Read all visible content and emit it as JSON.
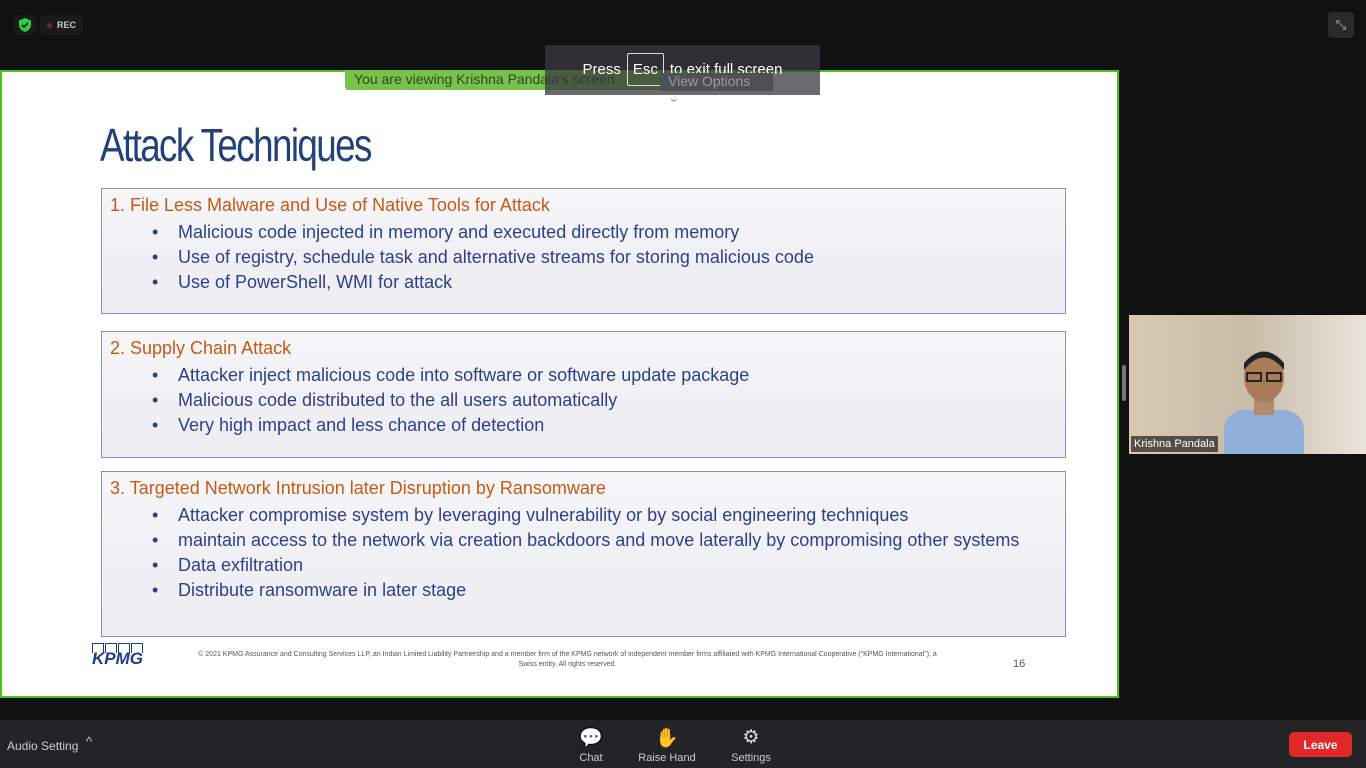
{
  "meeting": {
    "rec_label": "REC",
    "viewing_banner": "You are viewing Krishna Pandala's screen",
    "view_options": "View Options",
    "esc_hint": {
      "press": "Press",
      "key": "Esc",
      "rest": "to exit full screen"
    }
  },
  "slide": {
    "title": "Attack Techniques",
    "sections": [
      {
        "heading": "1. File Less Malware and Use of Native Tools for Attack",
        "bullets": [
          "Malicious code injected in memory and executed directly from memory",
          "Use of registry, schedule task and alternative streams for storing malicious code",
          "Use of PowerShell, WMI for attack"
        ]
      },
      {
        "heading": "2. Supply Chain Attack",
        "bullets": [
          "Attacker inject malicious code into software or software update package",
          "Malicious code distributed to the all users automatically",
          "Very high impact and less chance of detection"
        ]
      },
      {
        "heading": "3. Targeted Network Intrusion later Disruption by Ransomware",
        "bullets": [
          "Attacker compromise system by leveraging vulnerability or by social engineering techniques",
          "maintain access to the network via creation backdoors and move laterally by compromising other systems",
          "Data exfiltration",
          "Distribute ransomware in later stage"
        ]
      }
    ],
    "logo": "KPMG",
    "copyright": "© 2021 KPMG Assurance and Consulting Services LLP, an Indian Limited Liability Partnership and a member firm of the KPMG network of independent member firms affiliated with KPMG International Cooperative (\"KPMG International\"), a Swiss entity. All rights reserved.",
    "page_number": "16"
  },
  "video": {
    "name": "Krishna Pandala"
  },
  "toolbar": {
    "audio": "Audio Setting",
    "chat": "Chat",
    "raise_hand": "Raise Hand",
    "settings": "Settings",
    "leave": "Leave"
  }
}
